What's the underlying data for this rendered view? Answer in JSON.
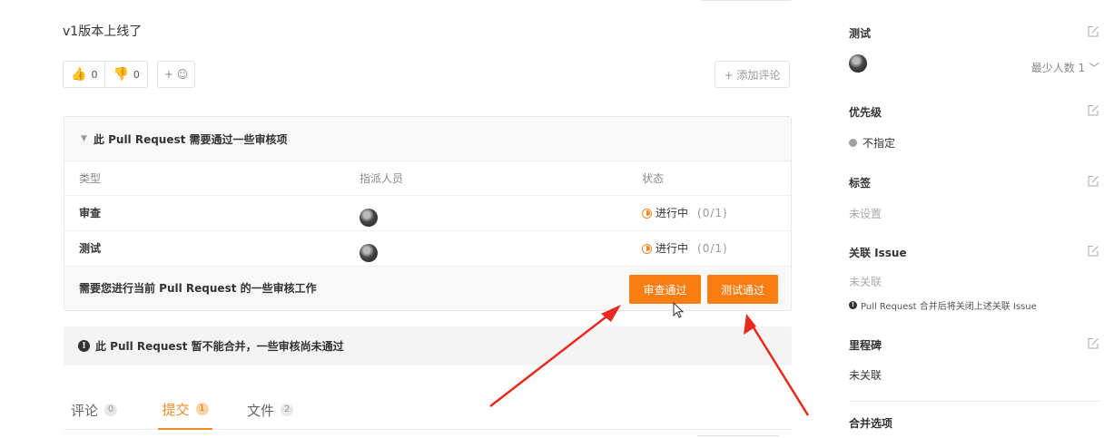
{
  "description": "v1版本上线了",
  "reactions": {
    "thumbs_up_count": "0",
    "thumbs_down_count": "0",
    "add_label": "+ ☺"
  },
  "add_comment_label": "+ 添加评论",
  "review": {
    "header": "此 Pull Request 需要通过一些审核项",
    "columns": [
      "类型",
      "指派人员",
      "状态"
    ],
    "rows": [
      {
        "type": "审查",
        "status": "进行中",
        "progress": "(0/1)"
      },
      {
        "type": "测试",
        "status": "进行中",
        "progress": "(0/1)"
      }
    ],
    "footer_msg": "需要您进行当前 Pull Request 的一些审核工作",
    "approve_review_label": "审查通过",
    "approve_test_label": "测试通过"
  },
  "merge_warning": "此 Pull Request 暂不能合并，一些审核尚未通过",
  "tabs": [
    {
      "label": "评论",
      "count": "0",
      "active": false
    },
    {
      "label": "提交",
      "count": "1",
      "active": true
    },
    {
      "label": "文件",
      "count": "2",
      "active": false
    }
  ],
  "sidebar": {
    "testers": {
      "title": "测试",
      "min_count": "最少人数 1"
    },
    "priority": {
      "title": "优先级",
      "value": "不指定"
    },
    "labels": {
      "title": "标签",
      "value": "未设置"
    },
    "issues": {
      "title": "关联 Issue",
      "value": "未关联",
      "note": "Pull Request 合并后将关闭上述关联 Issue"
    },
    "milestone": {
      "title": "里程碑",
      "value": "未关联"
    },
    "merge_options": {
      "title": "合并选项"
    }
  },
  "colors": {
    "accent": "#fa7d11",
    "status_orange": "#f08a24",
    "arrow_red": "#e8291f"
  }
}
